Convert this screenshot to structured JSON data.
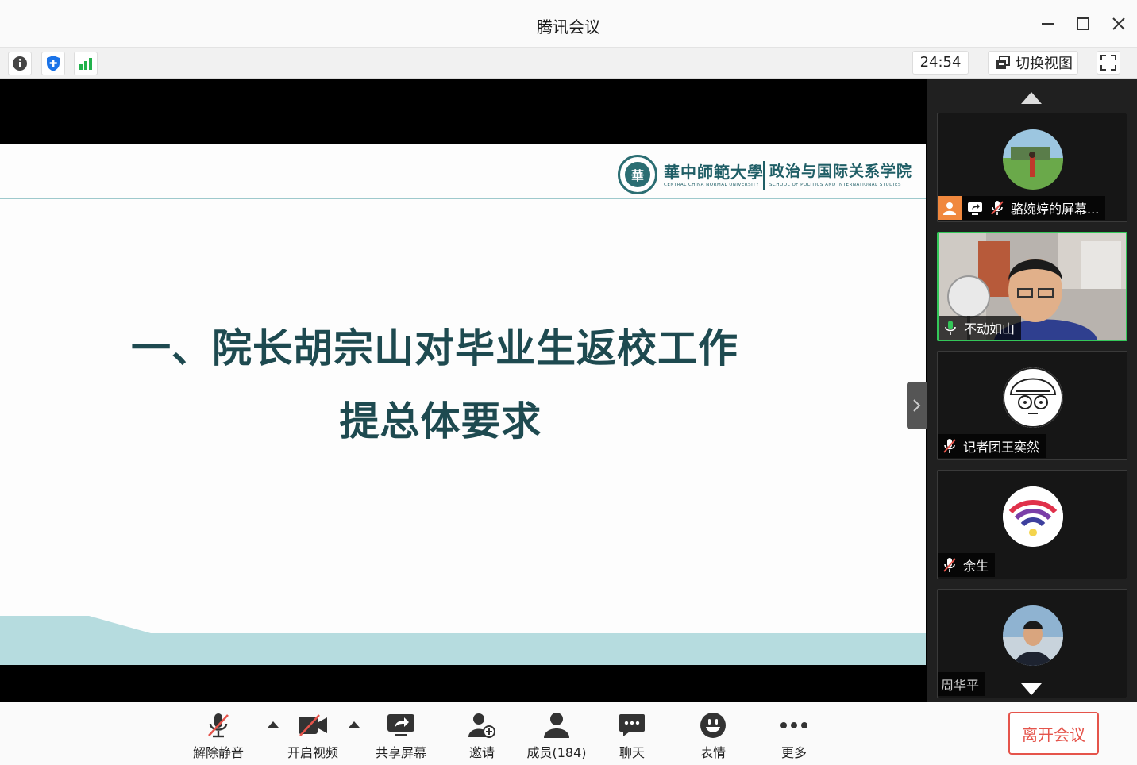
{
  "window": {
    "title": "腾讯会议"
  },
  "toolbar": {
    "info_icon": "info-icon",
    "security_icon": "shield-icon",
    "signal_icon": "signal-bars-icon",
    "timer": "24:54",
    "switch_view_label": "切换视图",
    "fullscreen_icon": "fullscreen-icon"
  },
  "slide": {
    "university_name": "華中師範大學",
    "university_en": "CENTRAL CHINA NORMAL UNIVERSITY",
    "school_name": "政治与国际关系学院",
    "school_en": "SCHOOL OF POLITICS AND INTERNATIONAL STUDIES",
    "title_line1": "一、院长胡宗山对毕业生返校工作",
    "title_line2": "提总体要求",
    "accent_color": "#1e4a50",
    "footer_color": "#b6dcdf"
  },
  "participants": [
    {
      "name": "骆婉婷的屏幕...",
      "sharing": true,
      "muted": true,
      "active": false
    },
    {
      "name": "不动如山",
      "sharing": false,
      "muted": false,
      "active": true
    },
    {
      "name": "记者团王奕然",
      "sharing": false,
      "muted": true,
      "active": false
    },
    {
      "name": "余生",
      "sharing": false,
      "muted": true,
      "active": false
    },
    {
      "name": "周华平",
      "sharing": false,
      "muted": false,
      "active": false
    }
  ],
  "bottombar": {
    "unmute": "解除静音",
    "start_video": "开启视频",
    "share_screen": "共享屏幕",
    "invite": "邀请",
    "members": "成员(184)",
    "chat": "聊天",
    "reactions": "表情",
    "more": "更多",
    "leave": "离开会议"
  }
}
